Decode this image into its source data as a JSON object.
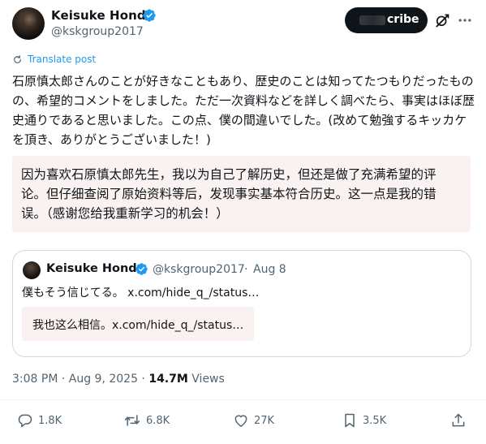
{
  "author": {
    "name": "Keisuke Honda",
    "handle": "@kskgroup2017"
  },
  "header": {
    "subscribe_label": "cribe"
  },
  "translate_label": "Translate post",
  "post_text": "石原慎太郎さんのことが好きなこともあり、歴史のことは知ってたつもりだったものの、希望的コメントをしました。ただ一次資料などを詳しく調べたら、事実はほぼ歴史通りであると思いました。この点、僕の間違いでした。(改めて勉強するキッカケを頂き、ありがとうございました！)",
  "translation_text": "因为喜欢石原慎太郎先生，我以为自己了解历史，但还是做了充满希望的评论。但仔细查阅了原始资料等后，发现事实基本符合历史。这一点是我的错误。（感谢您给我重新学习的机会！）",
  "quote": {
    "name": "Keisuke Honda",
    "handle": "@kskgroup2017",
    "separator": "·",
    "date": "Aug 8",
    "text": "僕もそう信じてる。 x.com/hide_q_/status…",
    "translation": "我也这么相信。x.com/hide_q_/status…"
  },
  "meta": {
    "time": "3:08 PM · Aug 9, 2025 · ",
    "views_count": "14.7M",
    "views_label": " Views"
  },
  "actions": {
    "replies": "1.8K",
    "reposts": "6.8K",
    "likes": "27K",
    "bookmarks": "3.5K"
  },
  "colors": {
    "accent": "#1d9bf0",
    "text": "#0f1419",
    "muted": "#536471",
    "translation_bg": "#faf1f1"
  },
  "icons": [
    "verified-badge-icon",
    "grok-icon",
    "more-icon",
    "translate-icon",
    "reply-icon",
    "repost-icon",
    "like-icon",
    "bookmark-icon",
    "share-icon"
  ]
}
